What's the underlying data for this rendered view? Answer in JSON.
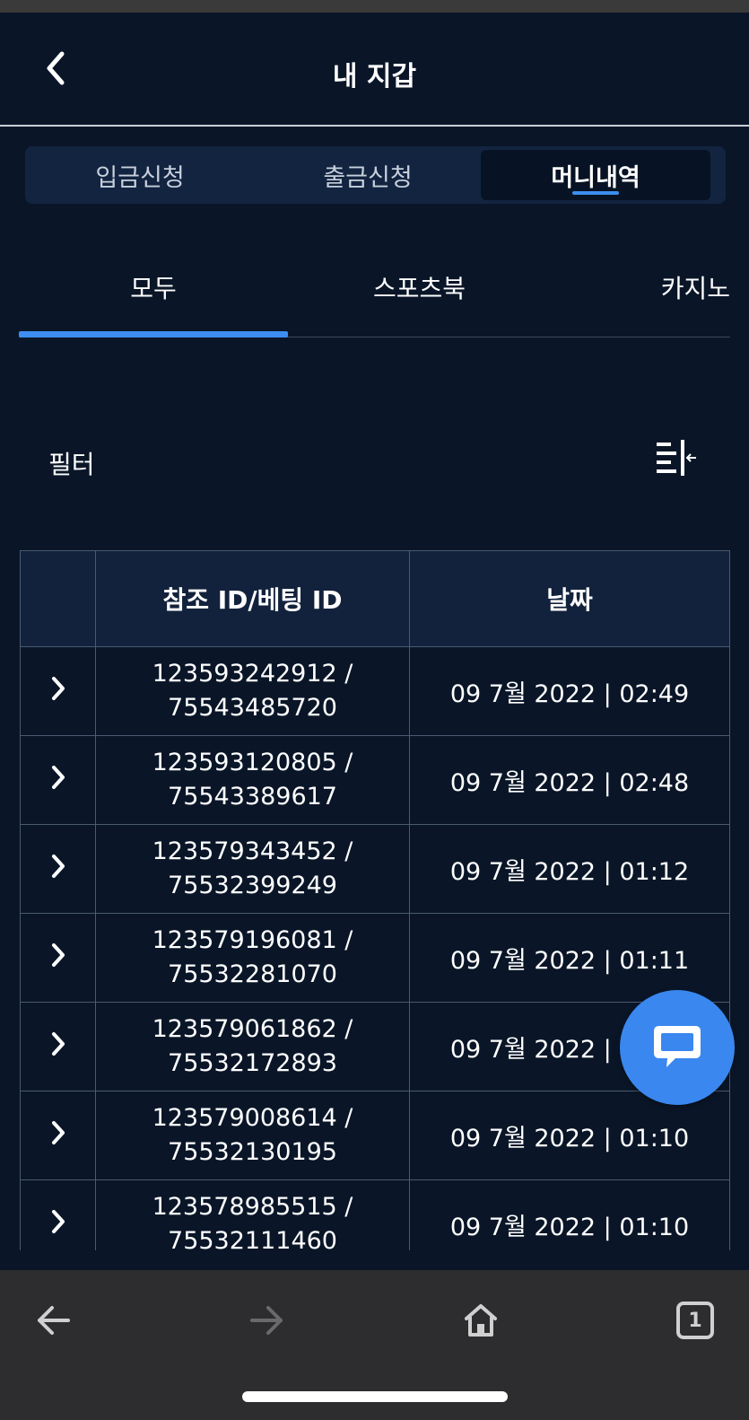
{
  "header": {
    "title": "내 지갑"
  },
  "segment_tabs": [
    {
      "label": "입금신청",
      "active": false
    },
    {
      "label": "출금신청",
      "active": false
    },
    {
      "label": "머니내역",
      "active": true
    }
  ],
  "category_tabs": [
    {
      "label": "모두",
      "active": true
    },
    {
      "label": "스포츠북",
      "active": false
    },
    {
      "label": "카지노",
      "active": false
    }
  ],
  "filter": {
    "label": "필터"
  },
  "table": {
    "headers": [
      "참조 ID/베팅 ID",
      "날짜"
    ],
    "rows": [
      {
        "ref_id": "123593242912 /",
        "bet_id": "75543485720",
        "date": "09 7월 2022 | 02:49"
      },
      {
        "ref_id": "123593120805 /",
        "bet_id": "75543389617",
        "date": "09 7월 2022 | 02:48"
      },
      {
        "ref_id": "123579343452 /",
        "bet_id": "75532399249",
        "date": "09 7월 2022 | 01:12"
      },
      {
        "ref_id": "123579196081 /",
        "bet_id": "75532281070",
        "date": "09 7월 2022 | 01:11"
      },
      {
        "ref_id": "123579061862 /",
        "bet_id": "75532172893",
        "date": "09 7월 2022 | 01:11"
      },
      {
        "ref_id": "123579008614 /",
        "bet_id": "75532130195",
        "date": "09 7월 2022 | 01:10"
      },
      {
        "ref_id": "123578985515 /",
        "bet_id": "75532111460",
        "date": "09 7월 2022 | 01:10"
      }
    ]
  },
  "browser_bar": {
    "tab_count": "1"
  },
  "colors": {
    "background": "#0a1628",
    "accent": "#3d8ef0",
    "chat_button": "#3a87ef"
  }
}
